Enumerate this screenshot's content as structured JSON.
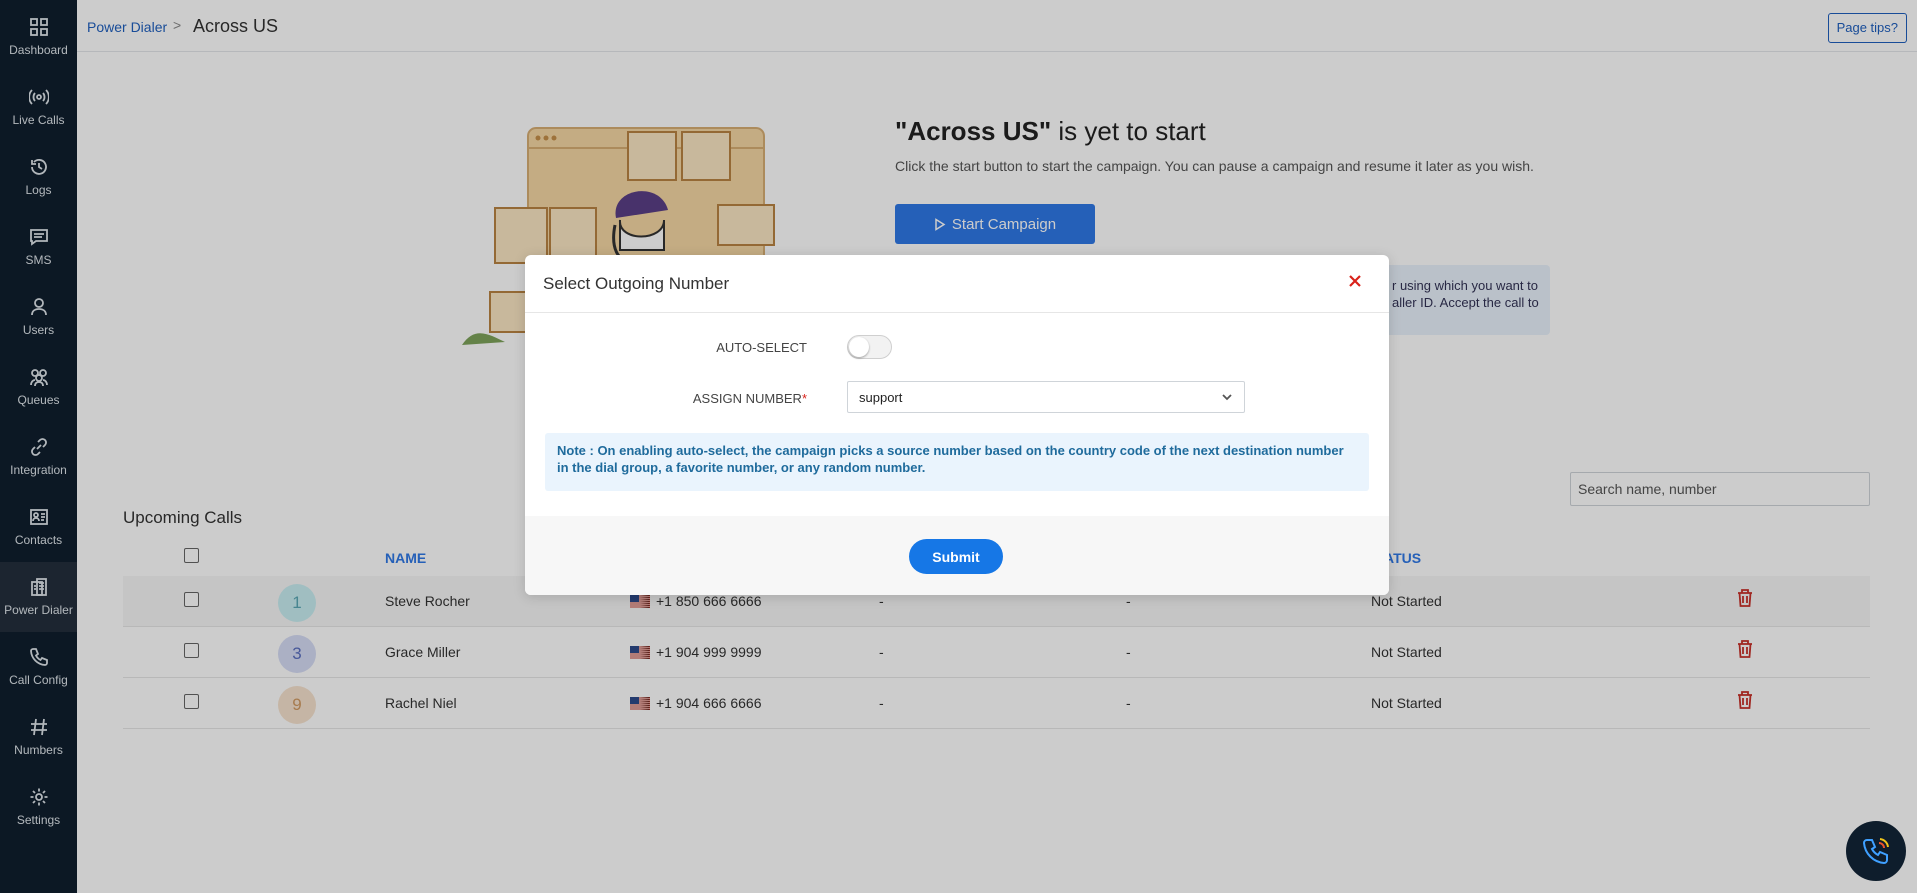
{
  "sidebar": {
    "items": [
      {
        "label": "Dashboard",
        "icon": "grid-icon"
      },
      {
        "label": "Live Calls",
        "icon": "broadcast-icon"
      },
      {
        "label": "Logs",
        "icon": "history-icon"
      },
      {
        "label": "SMS",
        "icon": "message-icon"
      },
      {
        "label": "Users",
        "icon": "user-icon"
      },
      {
        "label": "Queues",
        "icon": "group-icon"
      },
      {
        "label": "Integration",
        "icon": "link-icon"
      },
      {
        "label": "Contacts",
        "icon": "contact-card-icon"
      },
      {
        "label": "Power Dialer",
        "icon": "dialer-icon",
        "active": true
      },
      {
        "label": "Call Config",
        "icon": "phone-icon"
      },
      {
        "label": "Numbers",
        "icon": "hash-icon"
      },
      {
        "label": "Settings",
        "icon": "gear-icon"
      }
    ]
  },
  "breadcrumb": {
    "parent": "Power Dialer",
    "separator": ">",
    "current": "Across US"
  },
  "header": {
    "page_tips": "Page tips?"
  },
  "hero": {
    "campaign_name": "\"Across US\"",
    "title_rest": " is yet to start",
    "description": "Click the start button to start the campaign. You can pause a campaign and resume it later as you wish.",
    "start_button": "Start Campaign",
    "info_line1": "r using which you want to",
    "info_line2": "aller ID. Accept the call to"
  },
  "upcoming": {
    "title": "Upcoming Calls",
    "search_placeholder": "Search name, number",
    "columns": {
      "name": "NAME",
      "status": "ATUS"
    },
    "rows": [
      {
        "badge": "1",
        "name": "Steve Rocher",
        "phone": "+1 850 666 6666",
        "col3": "-",
        "col4": "-",
        "status": "Not Started"
      },
      {
        "badge": "3",
        "name": "Grace Miller",
        "phone": "+1 904 999 9999",
        "col3": "-",
        "col4": "-",
        "status": "Not Started"
      },
      {
        "badge": "9",
        "name": "Rachel Niel",
        "phone": "+1 904 666 6666",
        "col3": "-",
        "col4": "-",
        "status": "Not Started"
      }
    ]
  },
  "modal": {
    "title": "Select Outgoing Number",
    "auto_select_label": "AUTO-SELECT",
    "auto_select_on": false,
    "assign_number_label": "ASSIGN NUMBER",
    "required_mark": "*",
    "assign_number_value": "support",
    "note": "Note : On enabling auto-select, the campaign picks a source number based on the country code of the next destination number in the dial group, a favorite number, or any random number.",
    "submit": "Submit"
  },
  "colors": {
    "sidebar_bg": "#0f1e2e",
    "primary": "#2f78e6",
    "danger": "#d9221a",
    "submit": "#1677e6"
  }
}
